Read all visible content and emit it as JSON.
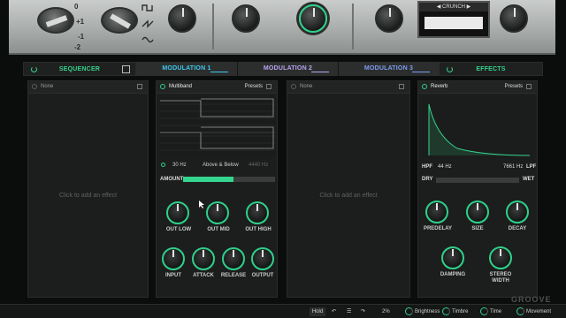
{
  "hardware": {
    "octave_labels": [
      "0",
      "+1",
      "-1",
      "-2"
    ],
    "wave_icons": [
      "square-wave-icon",
      "saw-wave-icon",
      "sine-wave-icon"
    ],
    "crunch_label": "CRUNCH"
  },
  "tabs": [
    {
      "label": "SEQUENCER",
      "color": "#34d58e"
    },
    {
      "label": "MODULATION 1",
      "color": "#3fc8ee"
    },
    {
      "label": "MODULATION 2",
      "color": "#b9a3f2"
    },
    {
      "label": "MODULATION 3",
      "color": "#7f9cf2"
    },
    {
      "label": "EFFECTS",
      "color": "#34d58e"
    }
  ],
  "slots": {
    "slot1": {
      "name": "None",
      "empty_text": "Click to add an effect"
    },
    "slot2": {
      "name": "Multiband",
      "presets": "Presets",
      "freq_low": "30 Hz",
      "mode": "Above & Below",
      "freq_high": "4440 Hz",
      "amount_label": "AMOUNT",
      "amount": 0.55,
      "knobs_row1": [
        "OUT LOW",
        "OUT MID",
        "OUT HIGH"
      ],
      "knobs_row2": [
        "INPUT",
        "ATTACK",
        "RELEASE",
        "OUTPUT"
      ]
    },
    "slot3": {
      "name": "None",
      "empty_text": "Click to add an effect"
    },
    "slot4": {
      "name": "Reverb",
      "presets": "Presets",
      "hpf_label": "HPF",
      "hpf_value": "44 Hz",
      "lpf_value": "7661 Hz",
      "lpf_label": "LPF",
      "dry_label": "DRY",
      "wet_label": "WET",
      "knobs_row1": [
        "PREDELAY",
        "SIZE",
        "DECAY"
      ],
      "knob_damping": "DAMPING",
      "knob_stereo": [
        "STEREO",
        "WIDTH"
      ]
    }
  },
  "bottom": {
    "hold": "Hold",
    "zoom": "2%",
    "macros": [
      "Brightness",
      "Timbre",
      "Time",
      "Movement"
    ]
  },
  "watermark": "GROOVE"
}
